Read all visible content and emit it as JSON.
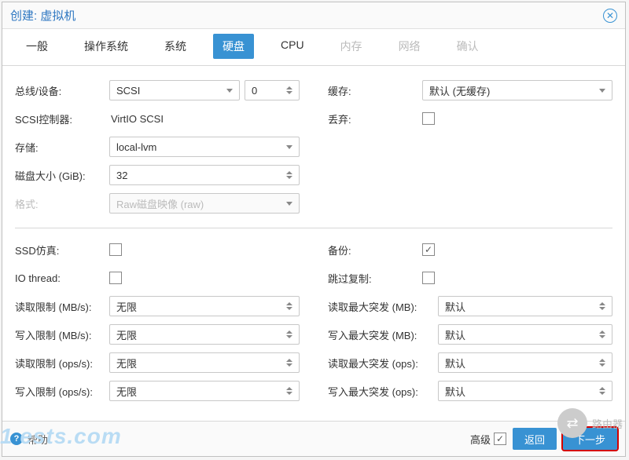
{
  "title": "创建: 虚拟机",
  "tabs": [
    "一般",
    "操作系统",
    "系统",
    "硬盘",
    "CPU",
    "内存",
    "网络",
    "确认"
  ],
  "active_tab": 3,
  "disabled_tabs": [
    5,
    6,
    7
  ],
  "left": {
    "bus_device_label": "总线/设备:",
    "bus_device_value": "SCSI",
    "bus_device_index": "0",
    "scsi_ctrl_label": "SCSI控制器:",
    "scsi_ctrl_value": "VirtIO SCSI",
    "storage_label": "存储:",
    "storage_value": "local-lvm",
    "disk_size_label": "磁盘大小 (GiB):",
    "disk_size_value": "32",
    "format_label": "格式:",
    "format_value": "Raw磁盘映像 (raw)"
  },
  "right": {
    "cache_label": "缓存:",
    "cache_value": "默认 (无缓存)",
    "discard_label": "丢弃:",
    "discard_checked": false
  },
  "adv_left": {
    "ssd_label": "SSD仿真:",
    "ssd_checked": false,
    "iothread_label": "IO thread:",
    "iothread_checked": false,
    "read_mb_label": "读取限制 (MB/s):",
    "read_mb_value": "无限",
    "write_mb_label": "写入限制 (MB/s):",
    "write_mb_value": "无限",
    "read_ops_label": "读取限制 (ops/s):",
    "read_ops_value": "无限",
    "write_ops_label": "写入限制 (ops/s):",
    "write_ops_value": "无限"
  },
  "adv_right": {
    "backup_label": "备份:",
    "backup_checked": true,
    "skip_repl_label": "跳过复制:",
    "skip_repl_checked": false,
    "read_burst_mb_label": "读取最大突发 (MB):",
    "read_burst_mb_value": "默认",
    "write_burst_mb_label": "写入最大突发 (MB):",
    "write_burst_mb_value": "默认",
    "read_burst_ops_label": "读取最大突发 (ops):",
    "read_burst_ops_value": "默认",
    "write_burst_ops_label": "写入最大突发 (ops):",
    "write_burst_ops_value": "默认"
  },
  "footer": {
    "help": "帮助",
    "advanced": "高级",
    "advanced_checked": true,
    "back": "返回",
    "next": "下一步"
  },
  "watermark": "1  ests.com",
  "wm_right": "路由器"
}
